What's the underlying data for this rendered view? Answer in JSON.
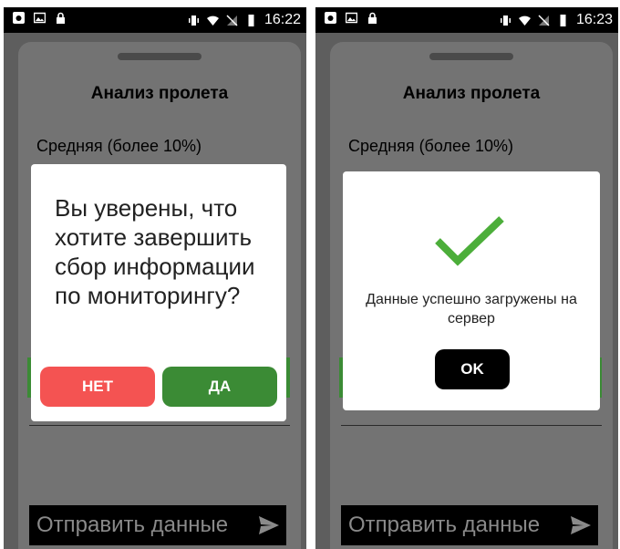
{
  "left": {
    "statusbar": {
      "time": "16:22"
    },
    "sheet": {
      "title": "Анализ пролета",
      "subtitle": "Средняя (более 10%)"
    },
    "dialog": {
      "question": "Вы уверены, что хотите завершить сбор информации по мониторингу?",
      "no_label": "НЕТ",
      "yes_label": "ДА"
    },
    "send_bar": {
      "label": "Отправить данные",
      "icon": "send-arrow-icon"
    }
  },
  "right": {
    "statusbar": {
      "time": "16:23"
    },
    "sheet": {
      "title": "Анализ пролета",
      "subtitle": "Средняя (более 10%)"
    },
    "dialog": {
      "icon": "checkmark-icon",
      "message": "Данные успешно загружены на сервер",
      "ok_label": "OK"
    },
    "send_bar": {
      "label": "Отправить данные",
      "icon": "send-arrow-icon"
    }
  },
  "colors": {
    "no_button": "#f45352",
    "yes_button": "#3b8b35",
    "check": "#4cae3a",
    "ok_button": "#000000"
  }
}
